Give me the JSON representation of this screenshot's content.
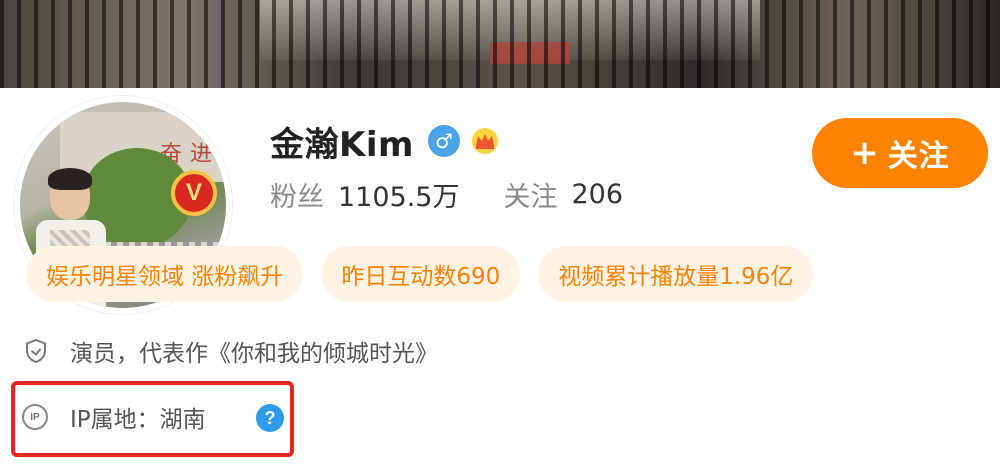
{
  "profile": {
    "name": "金瀚Kim",
    "gender_icon": "male-icon",
    "gender_symbol": "♂",
    "badge_icon": "crown-icon",
    "verified_mark": "V",
    "follow_button": {
      "plus": "+",
      "label": "关注"
    },
    "stats": {
      "fans_label": "粉丝",
      "fans_value": "1105.5万",
      "following_label": "关注",
      "following_value": "206"
    }
  },
  "tags": [
    {
      "label": "娱乐明星领域 涨粉飙升"
    },
    {
      "label": "昨日互动数690"
    },
    {
      "label": "视频累计播放量1.96亿"
    }
  ],
  "description": {
    "icon": "shield-icon",
    "text": "演员，代表作《你和我的倾城时光》"
  },
  "ip": {
    "icon_text": "IP",
    "text": "IP属地：湖南",
    "help_symbol": "?"
  },
  "colors": {
    "accent": "#ff8200",
    "tag_bg": "#fff3e6",
    "highlight_border": "#e42622",
    "help_blue": "#2f9ae8",
    "gender_blue": "#4aa3e6",
    "verified_red": "#d9281f"
  }
}
